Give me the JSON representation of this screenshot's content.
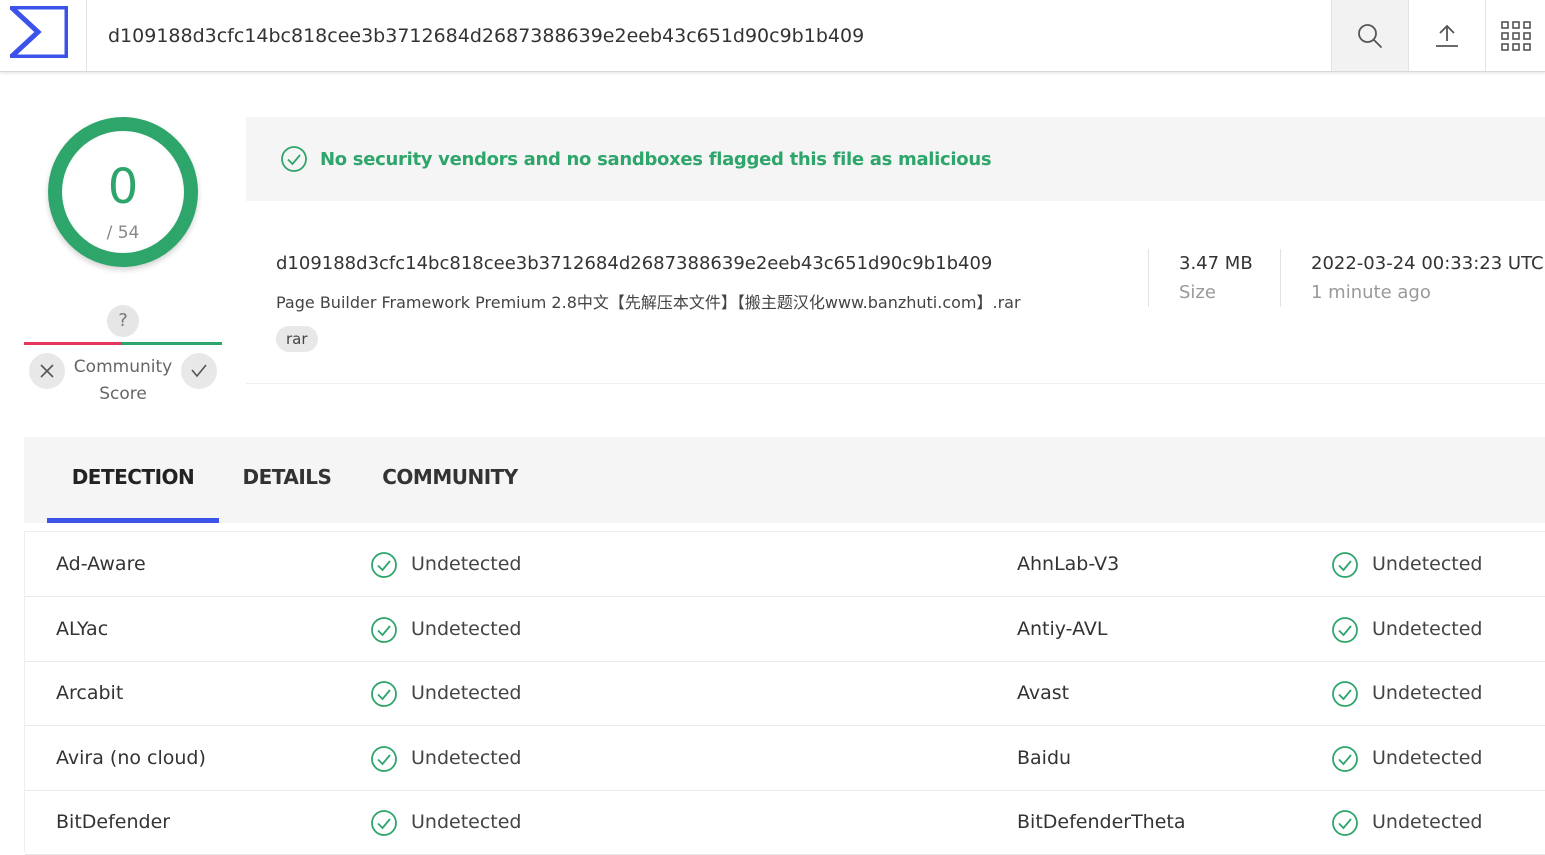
{
  "header": {
    "search_value": "d109188d3cfc14bc818cee3b3712684d2687388639e2eeb43c651d90c9b1b409",
    "icons": [
      "virustotal-logo",
      "search-icon",
      "upload-icon",
      "apps-grid-icon"
    ]
  },
  "score": {
    "detections": "0",
    "total": "/ 54",
    "community_unknown": "?",
    "community_label": "Community Score",
    "colors": {
      "ring": "#2ea56b",
      "negative": "#e4375b",
      "positive": "#2ea56b"
    }
  },
  "banner": {
    "message": "No security vendors and no sandboxes flagged this file as malicious",
    "color": "#2ea56b"
  },
  "file": {
    "hash": "d109188d3cfc14bc818cee3b3712684d2687388639e2eeb43c651d90c9b1b409",
    "name": "Page Builder Framework Premium 2.8中文【先解压本文件】【搬主题汉化www.banzhuti.com】.rar",
    "tag": "rar",
    "size": "3.47 MB",
    "size_label": "Size",
    "date": "2022-03-24 00:33:23 UTC",
    "date_relative": "1 minute ago"
  },
  "tabs": [
    {
      "label": "DETECTION",
      "active": true
    },
    {
      "label": "DETAILS",
      "active": false
    },
    {
      "label": "COMMUNITY",
      "active": false
    }
  ],
  "detections": [
    {
      "left_vendor": "Ad-Aware",
      "left_result": "Undetected",
      "right_vendor": "AhnLab-V3",
      "right_result": "Undetected"
    },
    {
      "left_vendor": "ALYac",
      "left_result": "Undetected",
      "right_vendor": "Antiy-AVL",
      "right_result": "Undetected"
    },
    {
      "left_vendor": "Arcabit",
      "left_result": "Undetected",
      "right_vendor": "Avast",
      "right_result": "Undetected"
    },
    {
      "left_vendor": "Avira (no cloud)",
      "left_result": "Undetected",
      "right_vendor": "Baidu",
      "right_result": "Undetected"
    },
    {
      "left_vendor": "BitDefender",
      "left_result": "Undetected",
      "right_vendor": "BitDefenderTheta",
      "right_result": "Undetected"
    }
  ]
}
